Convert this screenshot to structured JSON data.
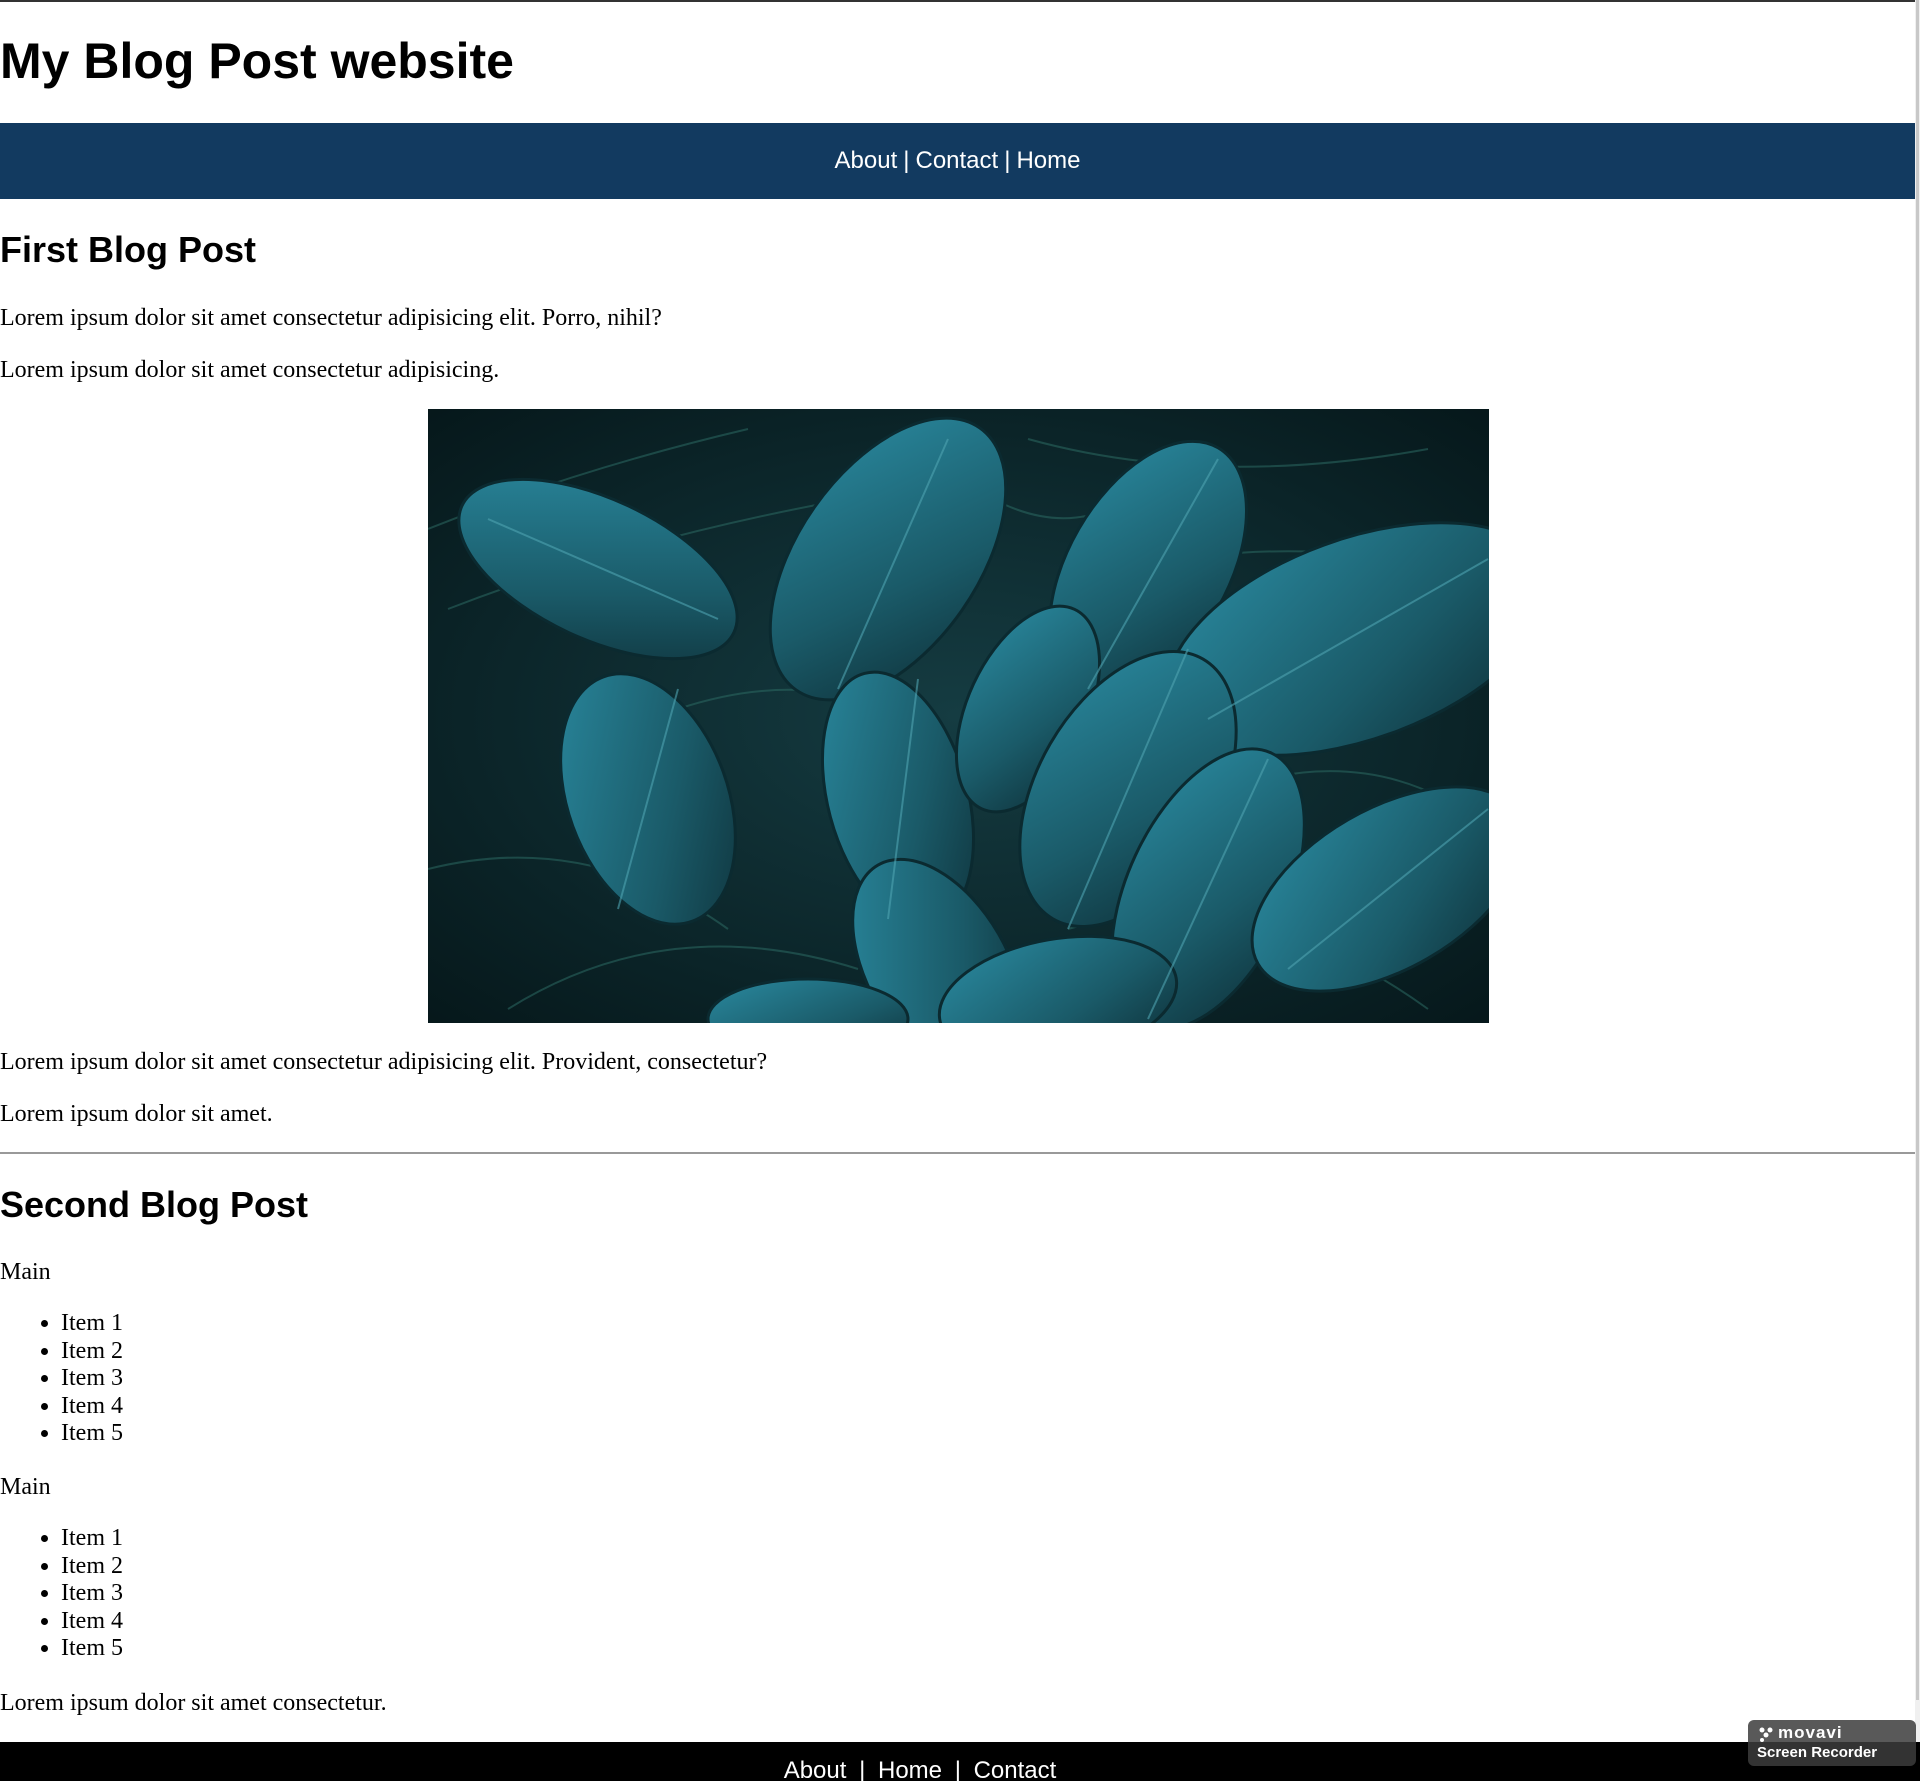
{
  "site": {
    "title": "My Blog Post website"
  },
  "nav": {
    "items": [
      {
        "label": "About"
      },
      {
        "label": "Contact"
      },
      {
        "label": "Home"
      }
    ],
    "separator": "|"
  },
  "post1": {
    "title": "First Blog Post",
    "para1": "Lorem ipsum dolor sit amet consectetur adipisicing elit. Porro, nihil?",
    "para2": "Lorem ipsum dolor sit amet consectetur adipisicing.",
    "image_subject": "teal tropical leaves",
    "para3": "Lorem ipsum dolor sit amet consectetur adipisicing elit. Provident, consectetur?",
    "para4": "Lorem ipsum dolor sit amet."
  },
  "post2": {
    "title": "Second Blog Post",
    "list1_label": "Main",
    "list1": [
      "Item 1",
      "Item 2",
      "Item 3",
      "Item 4",
      "Item 5"
    ],
    "list2_label": "Main",
    "list2": [
      "Item 1",
      "Item 2",
      "Item 3",
      "Item 4",
      "Item 5"
    ],
    "closing": "Lorem ipsum dolor sit amet consectetur."
  },
  "footer": {
    "items": [
      {
        "label": "About"
      },
      {
        "label": "Home"
      },
      {
        "label": "Contact"
      }
    ],
    "separator": "|"
  },
  "watermark": {
    "brand": "movavi",
    "subtitle": "Screen Recorder"
  },
  "colors": {
    "nav_bg": "#123a60",
    "footer_bg": "#000000",
    "leaf": "#1e6f80"
  }
}
